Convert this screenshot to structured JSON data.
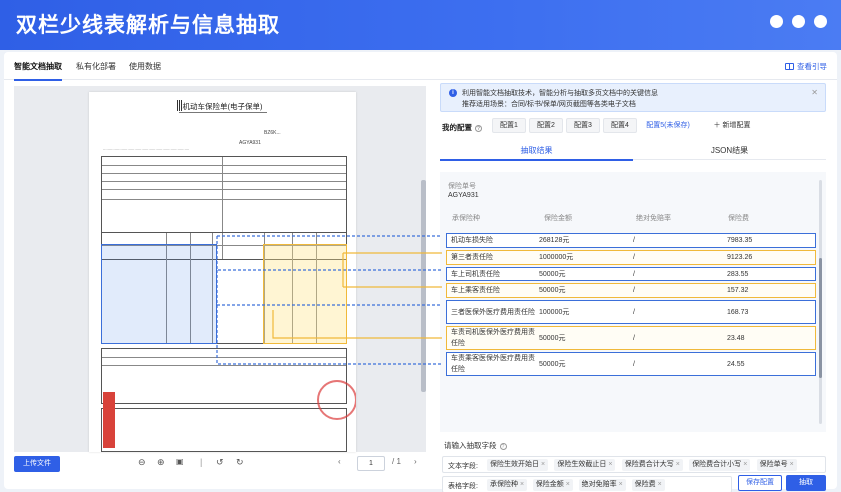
{
  "banner": {
    "title": "双栏少线表解析与信息抽取"
  },
  "nav": {
    "tabs": [
      {
        "label": "智能文档抽取",
        "active": true
      },
      {
        "label": "私有化部署",
        "active": false
      },
      {
        "label": "使用数据",
        "active": false
      }
    ],
    "guide_label": "查看引导"
  },
  "document": {
    "title": "机动车保险单(电子保单)",
    "policy_no_prefix": "AGYA931"
  },
  "left_toolbar": {
    "upload_label": "上传文件",
    "current_page": "1",
    "total_pages": "/ 1",
    "icons": [
      "zoom-out-icon",
      "zoom-in-icon",
      "fit-icon",
      "rotate-left-icon",
      "rotate-right-icon"
    ]
  },
  "info": {
    "line1": "利用智能文档抽取技术，智能分析与抽取多页文档中的关键信息",
    "line2": "推荐适用场景：合同/标书/保单/网页截图等各类电子文档"
  },
  "config": {
    "label": "我的配置",
    "tabs": [
      {
        "label": "配置1",
        "active": false
      },
      {
        "label": "配置2",
        "active": false
      },
      {
        "label": "配置3",
        "active": false
      },
      {
        "label": "配置4",
        "active": false
      },
      {
        "label": "配置5(未保存)",
        "active": true
      }
    ],
    "add_label": "新增配置"
  },
  "result_tabs": [
    {
      "label": "抽取结果",
      "active": true
    },
    {
      "label": "JSON结果",
      "active": false
    }
  ],
  "result": {
    "field_label": "保险单号",
    "field_value": "AGYA931",
    "columns": [
      "承保险种",
      "保险金额",
      "绝对免赔率",
      "保险费"
    ],
    "rows": [
      {
        "type": "机动车损失险",
        "amount": "268128元",
        "deductible": "/",
        "premium": "7983.35",
        "color": "blue"
      },
      {
        "type": "第三者责任险",
        "amount": "1000000元",
        "deductible": "/",
        "premium": "9123.26",
        "color": "yellow"
      },
      {
        "type": "车上司机责任险",
        "amount": "50000元",
        "deductible": "/",
        "premium": "283.55",
        "color": "blue"
      },
      {
        "type": "车上乘客责任险",
        "amount": "50000元",
        "deductible": "/",
        "premium": "157.32",
        "color": "yellow"
      },
      {
        "type": "三者医保外医疗费用责任险",
        "amount": "100000元",
        "deductible": "/",
        "premium": "168.73",
        "color": "blue"
      },
      {
        "type": "车责司机医保外医疗费用责任险",
        "amount": "50000元",
        "deductible": "/",
        "premium": "23.48",
        "color": "yellow"
      },
      {
        "type": "车责乘客医保外医疗费用责任险",
        "amount": "50000元",
        "deductible": "/",
        "premium": "24.55",
        "color": "blue"
      }
    ]
  },
  "add_field": {
    "label": "请输入抽取字段",
    "text_fields_label": "文本字段:",
    "text_fields": [
      "保险生效开始日",
      "保险生效截止日",
      "保险费合计大写",
      "保险费合计小写",
      "保险单号"
    ],
    "table_fields_label": "表格字段:",
    "table_fields": [
      "承保险种",
      "保险金额",
      "绝对免赔率",
      "保险费"
    ]
  },
  "buttons": {
    "save_label": "保存配置",
    "extract_label": "抽取"
  },
  "colors": {
    "accent": "#2f5fe6",
    "blue_highlight": "#3b6fd9",
    "yellow_highlight": "#f0b93a"
  }
}
